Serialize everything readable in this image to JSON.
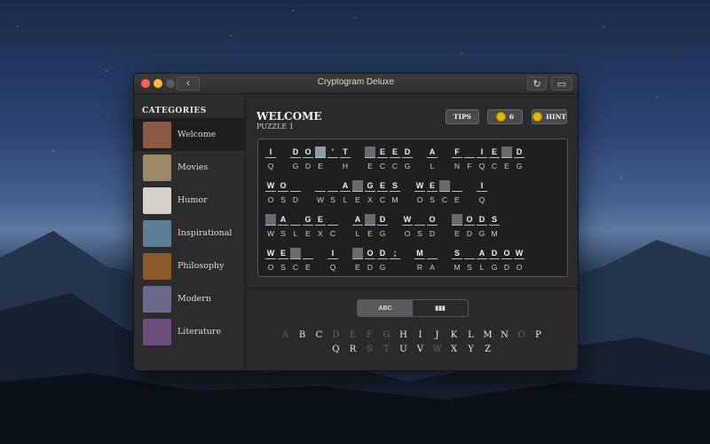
{
  "window": {
    "title": "Cryptogram Deluxe",
    "back_icon": "chevron-left-icon",
    "refresh_icon": "refresh-icon",
    "sidebar_icon": "sidebar-icon"
  },
  "sidebar": {
    "heading": "CATEGORIES",
    "items": [
      {
        "label": "Welcome",
        "active": true,
        "thumb_color": "#8a5a44"
      },
      {
        "label": "Movies",
        "active": false,
        "thumb_color": "#9c8a66"
      },
      {
        "label": "Humor",
        "active": false,
        "thumb_color": "#d6d0c8"
      },
      {
        "label": "Inspirational",
        "active": false,
        "thumb_color": "#5d7e97"
      },
      {
        "label": "Philosophy",
        "active": false,
        "thumb_color": "#8b5a2b"
      },
      {
        "label": "Modern",
        "active": false,
        "thumb_color": "#6a6a8a"
      },
      {
        "label": "Literature",
        "active": false,
        "thumb_color": "#6b4f7a"
      }
    ]
  },
  "puzzle": {
    "title": "WELCOME",
    "subtitle": "PUZZLE 1",
    "tips_label": "TIPS",
    "coins": "6",
    "hint_label": "HINT",
    "rows": [
      [
        {
          "p": "I",
          "c": "Q"
        },
        {
          "p": "",
          "c": "",
          "sp": 1
        },
        {
          "p": "D",
          "c": "G"
        },
        {
          "p": "O",
          "c": "D"
        },
        {
          "p": "",
          "c": "E",
          "sel": 2
        },
        {
          "p": "'",
          "c": ""
        },
        {
          "p": "T",
          "c": "H"
        },
        {
          "p": "",
          "c": "",
          "sp": 1
        },
        {
          "p": "",
          "c": "E",
          "sel": 1
        },
        {
          "p": "E",
          "c": "C"
        },
        {
          "p": "E",
          "c": "C"
        },
        {
          "p": "D",
          "c": "G"
        },
        {
          "p": "",
          "c": "",
          "sp": 1
        },
        {
          "p": "A",
          "c": "L"
        },
        {
          "p": "",
          "c": "",
          "sp": 1
        },
        {
          "p": "F",
          "c": "N"
        },
        {
          "p": "",
          "c": "F"
        },
        {
          "p": "I",
          "c": "Q"
        },
        {
          "p": "E",
          "c": "C"
        },
        {
          "p": "",
          "c": "E",
          "sel": 1
        },
        {
          "p": "D",
          "c": "G"
        }
      ],
      [
        {
          "p": "W",
          "c": "O"
        },
        {
          "p": "O",
          "c": "S"
        },
        {
          "p": "",
          "c": "D"
        },
        {
          "p": "",
          "c": "",
          "sp": 1
        },
        {
          "p": "",
          "c": "W"
        },
        {
          "p": "",
          "c": "S"
        },
        {
          "p": "A",
          "c": "L"
        },
        {
          "p": "",
          "c": "E",
          "sel": 1
        },
        {
          "p": "G",
          "c": "X"
        },
        {
          "p": "E",
          "c": "C"
        },
        {
          "p": "S",
          "c": "M"
        },
        {
          "p": "",
          "c": "",
          "sp": 1
        },
        {
          "p": "W",
          "c": "O"
        },
        {
          "p": "E",
          "c": "S"
        },
        {
          "p": "",
          "c": "C",
          "sel": 1
        },
        {
          "p": "",
          "c": "E"
        },
        {
          "p": "",
          "c": "",
          "sp": 1
        },
        {
          "p": "I",
          "c": "Q"
        }
      ],
      [
        {
          "p": "",
          "c": "W",
          "sel": 1
        },
        {
          "p": "A",
          "c": "S"
        },
        {
          "p": "",
          "c": "L"
        },
        {
          "p": "G",
          "c": "E"
        },
        {
          "p": "E",
          "c": "X"
        },
        {
          "p": "",
          "c": "C"
        },
        {
          "p": "",
          "c": "",
          "sp": 1
        },
        {
          "p": "A",
          "c": "L"
        },
        {
          "p": "",
          "c": "E",
          "sel": 1
        },
        {
          "p": "D",
          "c": "G"
        },
        {
          "p": "",
          "c": "",
          "sp": 1
        },
        {
          "p": "W",
          "c": "O"
        },
        {
          "p": "",
          "c": "S"
        },
        {
          "p": "O",
          "c": "D"
        },
        {
          "p": "",
          "c": "",
          "sp": 1
        },
        {
          "p": "",
          "c": "E",
          "sel": 1
        },
        {
          "p": "O",
          "c": "D"
        },
        {
          "p": "D",
          "c": "G"
        },
        {
          "p": "S",
          "c": "M"
        }
      ],
      [
        {
          "p": "W",
          "c": "O"
        },
        {
          "p": "E",
          "c": "S"
        },
        {
          "p": "",
          "c": "C",
          "sel": 1
        },
        {
          "p": "",
          "c": "E"
        },
        {
          "p": "",
          "c": "",
          "sp": 1
        },
        {
          "p": "I",
          "c": "Q"
        },
        {
          "p": "",
          "c": "",
          "sp": 1
        },
        {
          "p": "",
          "c": "E",
          "sel": 1
        },
        {
          "p": "O",
          "c": "D"
        },
        {
          "p": "D",
          "c": "G"
        },
        {
          "p": ";",
          "c": ""
        },
        {
          "p": "",
          "c": "",
          "sp": 1
        },
        {
          "p": "M",
          "c": "R"
        },
        {
          "p": "",
          "c": "A"
        },
        {
          "p": "",
          "c": "",
          "sp": 1
        },
        {
          "p": "S",
          "c": "M"
        },
        {
          "p": "",
          "c": "S"
        },
        {
          "p": "A",
          "c": "L"
        },
        {
          "p": "D",
          "c": "G"
        },
        {
          "p": "O",
          "c": "D"
        },
        {
          "p": "W",
          "c": "O"
        }
      ]
    ]
  },
  "toggle": {
    "left": "ABC",
    "right_icon": "bar-chart-icon"
  },
  "alphabet": {
    "row1": [
      {
        "l": "A",
        "u": 1
      },
      {
        "l": "B"
      },
      {
        "l": "C"
      },
      {
        "l": "D",
        "u": 1
      },
      {
        "l": "E",
        "u": 1
      },
      {
        "l": "F",
        "u": 1
      },
      {
        "l": "G",
        "u": 1
      },
      {
        "l": "H"
      },
      {
        "l": "I"
      },
      {
        "l": "J"
      },
      {
        "l": "K"
      },
      {
        "l": "L"
      },
      {
        "l": "M"
      },
      {
        "l": "N"
      },
      {
        "l": "O",
        "u": 1
      },
      {
        "l": "P"
      }
    ],
    "row2": [
      {
        "l": "Q"
      },
      {
        "l": "R"
      },
      {
        "l": "S",
        "u": 1
      },
      {
        "l": "T",
        "u": 1
      },
      {
        "l": "U"
      },
      {
        "l": "V"
      },
      {
        "l": "W",
        "u": 1
      },
      {
        "l": "X"
      },
      {
        "l": "Y"
      },
      {
        "l": "Z"
      }
    ]
  }
}
